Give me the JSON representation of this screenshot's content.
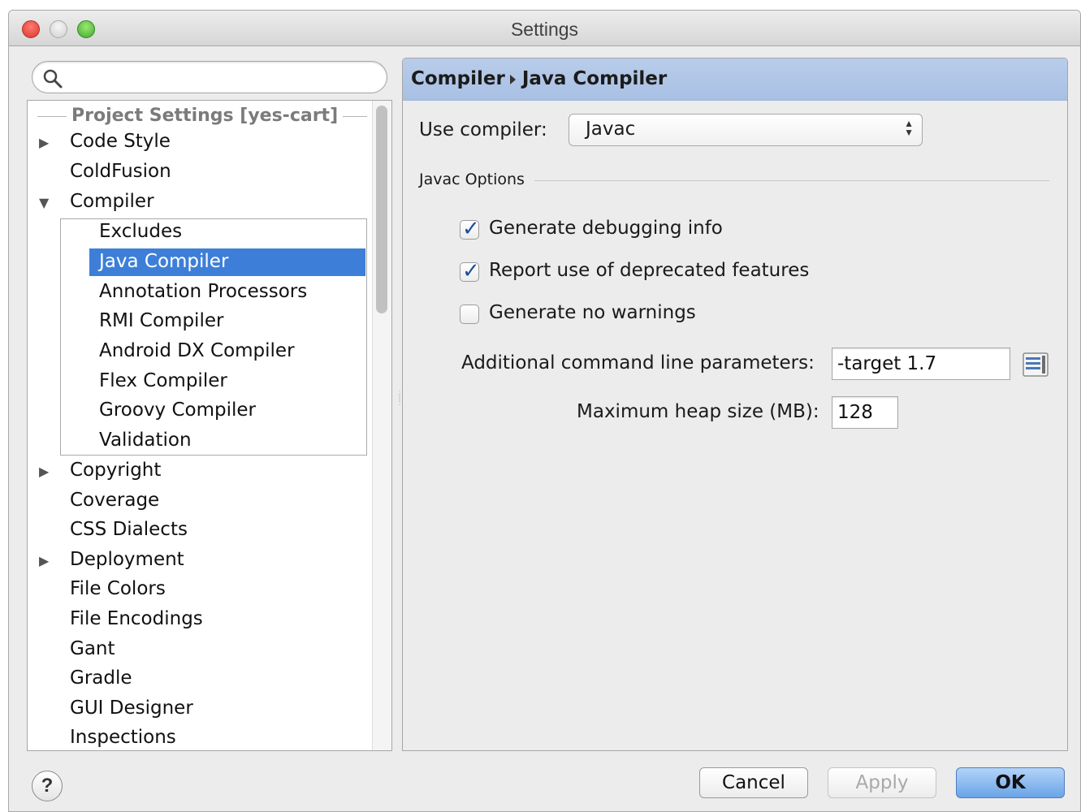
{
  "window": {
    "title": "Settings"
  },
  "search": {
    "value": "",
    "placeholder": ""
  },
  "tree": {
    "group_header": "Project Settings [yes-cart]",
    "items": [
      {
        "label": "Code Style",
        "arrow": "▶"
      },
      {
        "label": "ColdFusion",
        "arrow": ""
      },
      {
        "label": "Compiler",
        "arrow": "▼"
      },
      {
        "label": "Copyright",
        "arrow": "▶"
      },
      {
        "label": "Coverage",
        "arrow": ""
      },
      {
        "label": "CSS Dialects",
        "arrow": ""
      },
      {
        "label": "Deployment",
        "arrow": "▶"
      },
      {
        "label": "File Colors",
        "arrow": ""
      },
      {
        "label": "File Encodings",
        "arrow": ""
      },
      {
        "label": "Gant",
        "arrow": ""
      },
      {
        "label": "Gradle",
        "arrow": ""
      },
      {
        "label": "GUI Designer",
        "arrow": ""
      },
      {
        "label": "Inspections",
        "arrow": ""
      }
    ],
    "compiler_children": [
      {
        "label": "Excludes"
      },
      {
        "label": "Java Compiler",
        "selected": true
      },
      {
        "label": "Annotation Processors"
      },
      {
        "label": "RMI Compiler"
      },
      {
        "label": "Android DX Compiler"
      },
      {
        "label": "Flex Compiler"
      },
      {
        "label": "Groovy Compiler"
      },
      {
        "label": "Validation"
      }
    ]
  },
  "panel": {
    "breadcrumb": [
      "Compiler",
      "Java Compiler"
    ],
    "use_compiler_label": "Use compiler:",
    "compiler_value": "Javac",
    "section_label": "Javac Options",
    "options": [
      {
        "label": "Generate debugging info",
        "checked": true
      },
      {
        "label": "Report use of deprecated features",
        "checked": true
      },
      {
        "label": "Generate no warnings",
        "checked": false
      }
    ],
    "cmd_params_label": "Additional command line parameters:",
    "cmd_params_value": "-target 1.7",
    "heap_label": "Maximum heap size (MB):",
    "heap_value": "128"
  },
  "footer": {
    "help_label": "?",
    "cancel_label": "Cancel",
    "apply_label": "Apply",
    "ok_label": "OK"
  },
  "colors": {
    "selection": "#3d7fd8",
    "panel_header": "#a8c0e4",
    "ok_button": "#6aa4e8"
  }
}
